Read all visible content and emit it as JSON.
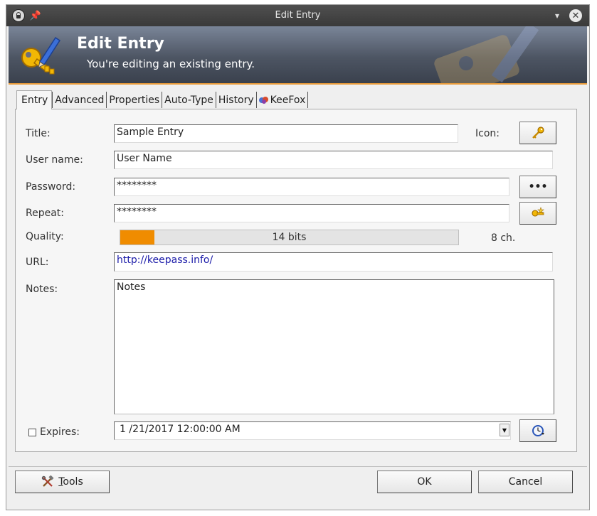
{
  "window": {
    "title": "Edit Entry"
  },
  "banner": {
    "title": "Edit Entry",
    "subtitle": "You're editing an existing entry."
  },
  "tabs": [
    "Entry",
    "Advanced",
    "Properties",
    "Auto-Type",
    "History",
    "KeeFox"
  ],
  "form": {
    "title_label": "Title:",
    "title_value": "Sample Entry",
    "icon_label": "Icon:",
    "username_label": "User name:",
    "username_value": "User Name",
    "password_label": "Password:",
    "password_value": "********",
    "show_password_button": "•••",
    "repeat_label": "Repeat:",
    "repeat_value": "********",
    "quality_label": "Quality:",
    "quality_text": "14 bits",
    "quality_fraction": 0.1,
    "quality_chars": "8 ch.",
    "url_label": "URL:",
    "url_value": "http://keepass.info/",
    "notes_label": "Notes:",
    "notes_value": "Notes",
    "expires_label": "Expires:",
    "expires_checked": false,
    "expires_value": "1 /21/2017 12:00:00 AM"
  },
  "buttons": {
    "tools_prefix": "",
    "tools_underlined": "T",
    "tools_rest": "ools",
    "ok": "OK",
    "cancel": "Cancel"
  },
  "icons": {
    "window": "lock-icon",
    "pin": "pin-icon",
    "minimize": "minimize-icon",
    "close": "close-icon",
    "banner": "key-pencil-icon",
    "entry_icon": "key-icon",
    "generate": "password-generator-icon",
    "expiry_presets": "clock-icon",
    "tools": "tools-icon",
    "keefox": "keefox-icon"
  },
  "colors": {
    "accent": "#e89b3a",
    "quality_fill": "#f08c00",
    "url": "#1a1aa8"
  }
}
